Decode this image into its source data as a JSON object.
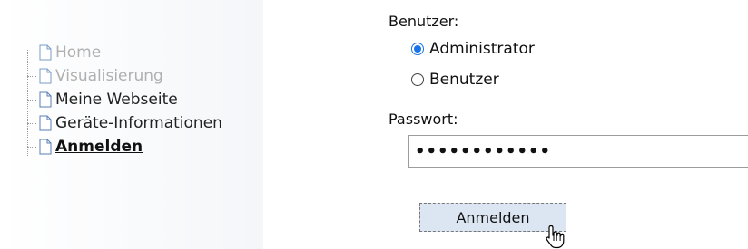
{
  "nav": {
    "items": [
      {
        "label": "Home",
        "state": "disabled"
      },
      {
        "label": "Visualisierung",
        "state": "disabled"
      },
      {
        "label": "Meine Webseite",
        "state": "normal"
      },
      {
        "label": "Geräte-Informationen",
        "state": "normal"
      },
      {
        "label": "Anmelden",
        "state": "active"
      }
    ]
  },
  "login": {
    "user_label": "Benutzer:",
    "user_options": [
      {
        "label": "Administrator",
        "checked": true
      },
      {
        "label": "Benutzer",
        "checked": false
      }
    ],
    "password_label": "Passwort:",
    "password_value": "••••••••••••",
    "submit_label": "Anmelden"
  },
  "icons": {
    "tree_item": "document-icon",
    "cursor": "hand-pointer-icon"
  },
  "colors": {
    "radio_accent": "#1a73e8",
    "button_bg": "#dce6f2",
    "disabled_text": "#b0b0b0"
  }
}
